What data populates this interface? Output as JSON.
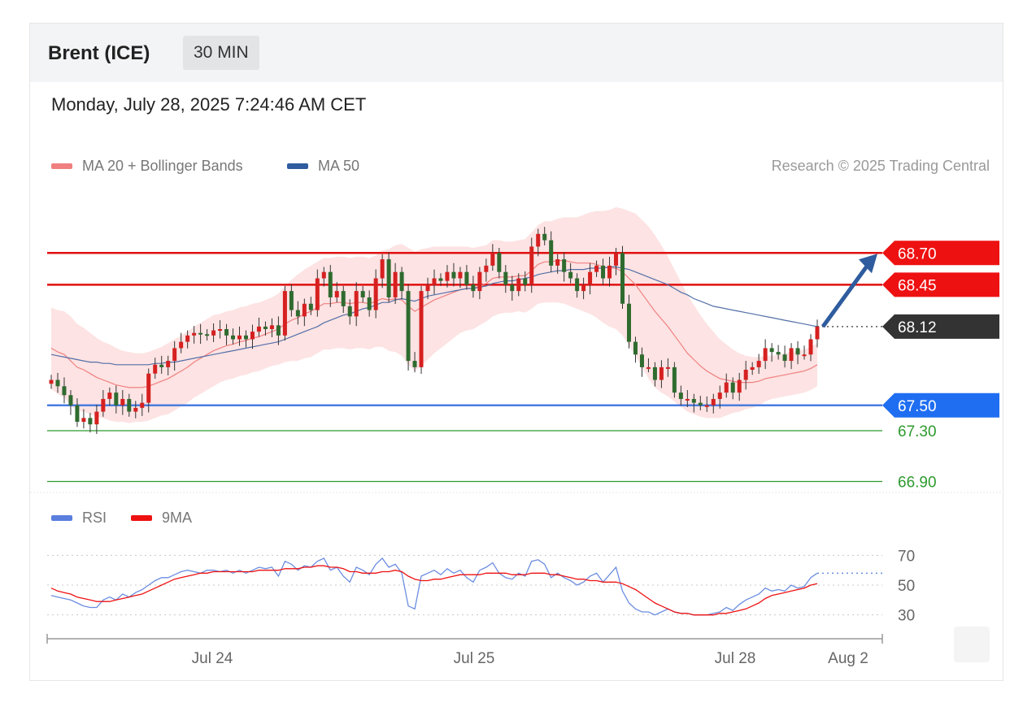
{
  "header": {
    "title": "Brent (ICE)",
    "timeframe": "30 MIN",
    "datetime": "Monday, July 28, 2025 7:24:46 AM CET"
  },
  "legend": {
    "ma20_label": "MA 20 + Bollinger Bands",
    "ma20_color": "#f08080",
    "ma50_label": "MA 50",
    "ma50_color": "#2e5c9e",
    "credit": "Research © 2025 Trading Central"
  },
  "rsi_legend": {
    "rsi_label": "RSI",
    "rsi_color": "#5b7fde",
    "ma9_label": "9MA",
    "ma9_color": "#e11"
  },
  "chart_data": [
    {
      "type": "candlestick",
      "title": "Brent (ICE)",
      "x_ticks": [
        "Jul 24",
        "Jul 25",
        "Jul 28",
        "Aug 2"
      ],
      "y_range": [
        66.82,
        69.22
      ],
      "last_price": 68.12,
      "levels": [
        {
          "value": 68.7,
          "label": "68.70",
          "type": "resistance",
          "color": "#e01010",
          "tag_color": "#ee1111"
        },
        {
          "value": 68.45,
          "label": "68.45",
          "type": "resistance",
          "color": "#e01010",
          "tag_color": "#ee1111"
        },
        {
          "value": 68.12,
          "label": "68.12",
          "type": "last",
          "color": "#555555",
          "tag_color": "#333333"
        },
        {
          "value": 67.5,
          "label": "67.50",
          "type": "pivot",
          "color": "#4a7de0",
          "tag_color": "#1f6ef2"
        },
        {
          "value": 67.3,
          "label": "67.30",
          "type": "support",
          "color": "#2e9a2e",
          "tag_color": "#2e9a2e"
        },
        {
          "value": 66.9,
          "label": "66.90",
          "type": "support",
          "color": "#2e9a2e",
          "tag_color": "#2e9a2e"
        }
      ],
      "forecast_arrow": {
        "from": 68.12,
        "to": 68.7,
        "color": "#2e5c9e"
      },
      "closes": [
        67.7,
        67.65,
        67.58,
        67.5,
        67.37,
        67.4,
        67.35,
        67.45,
        67.55,
        67.6,
        67.5,
        67.55,
        67.45,
        67.48,
        67.52,
        67.75,
        67.82,
        67.8,
        67.85,
        67.95,
        68.0,
        68.05,
        68.07,
        68.06,
        68.05,
        68.09,
        68.1,
        68.05,
        68.02,
        68.05,
        68.02,
        68.08,
        68.12,
        68.1,
        68.13,
        68.05,
        68.4,
        68.25,
        68.2,
        68.3,
        68.25,
        68.5,
        68.55,
        68.35,
        68.4,
        68.28,
        68.2,
        68.4,
        68.35,
        68.25,
        68.5,
        68.65,
        68.35,
        68.55,
        68.4,
        67.85,
        67.8,
        68.4,
        68.45,
        68.5,
        68.48,
        68.55,
        68.5,
        68.55,
        68.45,
        68.4,
        68.55,
        68.6,
        68.7,
        68.55,
        68.45,
        68.4,
        68.5,
        68.45,
        68.75,
        68.85,
        68.8,
        68.6,
        68.65,
        68.55,
        68.5,
        68.4,
        68.45,
        68.55,
        68.6,
        68.5,
        68.6,
        68.7,
        68.3,
        68.0,
        67.9,
        67.8,
        67.8,
        67.7,
        67.8,
        67.8,
        67.6,
        67.55,
        67.55,
        67.52,
        67.5,
        67.5,
        67.55,
        67.6,
        67.68,
        67.6,
        67.7,
        67.78,
        67.8,
        67.85,
        67.95,
        67.92,
        67.9,
        67.85,
        67.95,
        67.9,
        67.9,
        68.02,
        68.12
      ],
      "ma20": [
        67.95,
        67.92,
        67.9,
        67.85,
        67.8,
        67.78,
        67.75,
        67.72,
        67.7,
        67.68,
        67.66,
        67.65,
        67.64,
        67.64,
        67.64,
        67.65,
        67.67,
        67.69,
        67.71,
        67.74,
        67.77,
        67.8,
        67.84,
        67.87,
        67.9,
        67.93,
        67.95,
        67.97,
        67.98,
        68.0,
        68.01,
        68.03,
        68.04,
        68.06,
        68.08,
        68.1,
        68.14,
        68.17,
        68.19,
        68.22,
        68.24,
        68.27,
        68.3,
        68.3,
        68.31,
        68.31,
        68.3,
        68.31,
        68.31,
        68.3,
        68.32,
        68.34,
        68.33,
        68.34,
        68.33,
        68.28,
        68.24,
        68.27,
        68.3,
        68.33,
        68.35,
        68.37,
        68.39,
        68.41,
        68.42,
        68.42,
        68.44,
        68.46,
        68.5,
        68.51,
        68.51,
        68.51,
        68.52,
        68.52,
        68.56,
        68.61,
        68.63,
        68.63,
        68.64,
        68.64,
        68.63,
        68.62,
        68.62,
        68.62,
        68.61,
        68.59,
        68.58,
        68.58,
        68.55,
        68.5,
        68.45,
        68.38,
        68.31,
        68.24,
        68.18,
        68.12,
        68.05,
        67.98,
        67.91,
        67.86,
        67.81,
        67.77,
        67.74,
        67.71,
        67.7,
        67.69,
        67.68,
        67.68,
        67.68,
        67.69,
        67.71,
        67.72,
        67.73,
        67.74,
        67.75,
        67.76,
        67.77,
        67.79,
        67.82
      ],
      "ma50": [
        67.9,
        67.89,
        67.88,
        67.87,
        67.86,
        67.85,
        67.84,
        67.84,
        67.83,
        67.83,
        67.82,
        67.82,
        67.82,
        67.82,
        67.82,
        67.82,
        67.83,
        67.83,
        67.84,
        67.84,
        67.85,
        67.86,
        67.87,
        67.88,
        67.89,
        67.9,
        67.91,
        67.92,
        67.93,
        67.94,
        67.95,
        67.96,
        67.97,
        67.98,
        67.99,
        68.0,
        68.02,
        68.04,
        68.06,
        68.08,
        68.1,
        68.12,
        68.15,
        68.17,
        68.19,
        68.21,
        68.22,
        68.24,
        68.26,
        68.27,
        68.29,
        68.31,
        68.31,
        68.33,
        68.34,
        68.33,
        68.32,
        68.34,
        68.36,
        68.37,
        68.38,
        68.39,
        68.4,
        68.41,
        68.42,
        68.42,
        68.43,
        68.44,
        68.46,
        68.47,
        68.48,
        68.48,
        68.49,
        68.5,
        68.51,
        68.53,
        68.54,
        68.55,
        68.56,
        68.56,
        68.57,
        68.57,
        68.57,
        68.58,
        68.58,
        68.58,
        68.59,
        68.59,
        68.58,
        68.57,
        68.55,
        68.53,
        68.51,
        68.49,
        68.47,
        68.45,
        68.42,
        68.39,
        68.37,
        68.34,
        68.32,
        68.3,
        68.28,
        68.27,
        68.26,
        68.25,
        68.24,
        68.23,
        68.22,
        68.21,
        68.2,
        68.19,
        68.18,
        68.17,
        68.16,
        68.15,
        68.14,
        68.13,
        68.12
      ],
      "band_width": [
        0.32,
        0.33,
        0.34,
        0.35,
        0.34,
        0.33,
        0.32,
        0.31,
        0.3,
        0.3,
        0.29,
        0.28,
        0.28,
        0.27,
        0.27,
        0.27,
        0.27,
        0.27,
        0.28,
        0.28,
        0.28,
        0.28,
        0.28,
        0.28,
        0.28,
        0.28,
        0.27,
        0.27,
        0.27,
        0.27,
        0.27,
        0.27,
        0.27,
        0.27,
        0.27,
        0.28,
        0.3,
        0.32,
        0.34,
        0.35,
        0.36,
        0.36,
        0.36,
        0.36,
        0.36,
        0.36,
        0.36,
        0.36,
        0.36,
        0.36,
        0.36,
        0.38,
        0.4,
        0.42,
        0.44,
        0.46,
        0.47,
        0.46,
        0.44,
        0.42,
        0.4,
        0.38,
        0.36,
        0.34,
        0.33,
        0.32,
        0.31,
        0.3,
        0.3,
        0.29,
        0.28,
        0.28,
        0.28,
        0.29,
        0.3,
        0.31,
        0.32,
        0.32,
        0.33,
        0.34,
        0.35,
        0.36,
        0.38,
        0.4,
        0.42,
        0.44,
        0.46,
        0.48,
        0.5,
        0.53,
        0.56,
        0.58,
        0.6,
        0.6,
        0.58,
        0.55,
        0.52,
        0.49,
        0.46,
        0.43,
        0.4,
        0.37,
        0.34,
        0.31,
        0.28,
        0.25,
        0.23,
        0.21,
        0.2,
        0.19,
        0.18,
        0.17,
        0.17,
        0.17,
        0.17,
        0.17,
        0.17,
        0.17,
        0.17
      ]
    },
    {
      "type": "line",
      "title": "RSI",
      "y_ticks": [
        30,
        50,
        70
      ],
      "y_range": [
        20,
        80
      ],
      "series": [
        {
          "name": "RSI",
          "values": [
            43,
            42,
            41,
            40,
            38,
            36,
            35,
            35,
            40,
            42,
            40,
            44,
            42,
            45,
            47,
            50,
            53,
            55,
            55,
            57,
            59,
            60,
            59,
            58,
            60,
            60,
            59,
            60,
            58,
            60,
            58,
            60,
            62,
            61,
            62,
            56,
            66,
            64,
            60,
            63,
            62,
            66,
            68,
            60,
            62,
            56,
            52,
            62,
            60,
            57,
            64,
            68,
            62,
            64,
            58,
            36,
            34,
            56,
            58,
            60,
            57,
            61,
            58,
            60,
            55,
            52,
            60,
            62,
            65,
            58,
            55,
            54,
            58,
            56,
            66,
            67,
            64,
            55,
            58,
            55,
            53,
            50,
            52,
            56,
            58,
            52,
            57,
            62,
            46,
            38,
            34,
            32,
            32,
            30,
            32,
            34,
            32,
            31,
            31,
            30,
            30,
            30,
            31,
            32,
            35,
            33,
            37,
            40,
            42,
            44,
            48,
            46,
            47,
            46,
            50,
            48,
            49,
            55,
            58
          ]
        },
        {
          "name": "9MA",
          "values": [
            48,
            46,
            45,
            44,
            42,
            41,
            40,
            39,
            39,
            39,
            40,
            41,
            42,
            43,
            44,
            46,
            48,
            50,
            52,
            54,
            55,
            56,
            57,
            58,
            58,
            59,
            59,
            59,
            59,
            59,
            59,
            59,
            60,
            60,
            60,
            60,
            61,
            61,
            61,
            62,
            62,
            63,
            63,
            62,
            62,
            61,
            59,
            59,
            58,
            58,
            58,
            59,
            59,
            60,
            59,
            56,
            54,
            53,
            53,
            54,
            54,
            55,
            56,
            57,
            57,
            57,
            57,
            58,
            58,
            58,
            58,
            57,
            57,
            57,
            58,
            58,
            58,
            57,
            57,
            56,
            55,
            54,
            54,
            53,
            53,
            52,
            52,
            52,
            51,
            49,
            47,
            44,
            41,
            38,
            36,
            34,
            32,
            31,
            31,
            30,
            30,
            30,
            30,
            31,
            31,
            32,
            33,
            34,
            36,
            38,
            41,
            43,
            44,
            45,
            46,
            47,
            48,
            50,
            51
          ]
        }
      ]
    }
  ]
}
